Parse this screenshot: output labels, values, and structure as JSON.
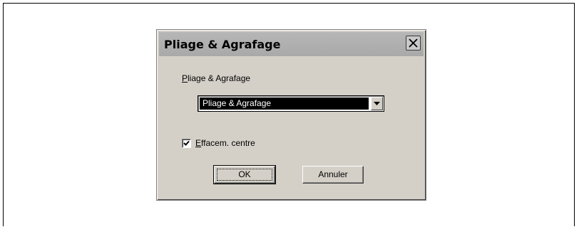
{
  "dialog": {
    "title": "Pliage & Agrafage",
    "close_icon": "close-icon",
    "group_label_first": "P",
    "group_label_rest": "liage & Agrafage",
    "select": {
      "value": "Pliage & Agrafage",
      "arrow_icon": "chevron-down-icon"
    },
    "checkbox": {
      "checked": true,
      "label_first": "E",
      "label_rest": "ffacem. centre"
    },
    "ok_label": "OK",
    "cancel_label": "Annuler"
  }
}
